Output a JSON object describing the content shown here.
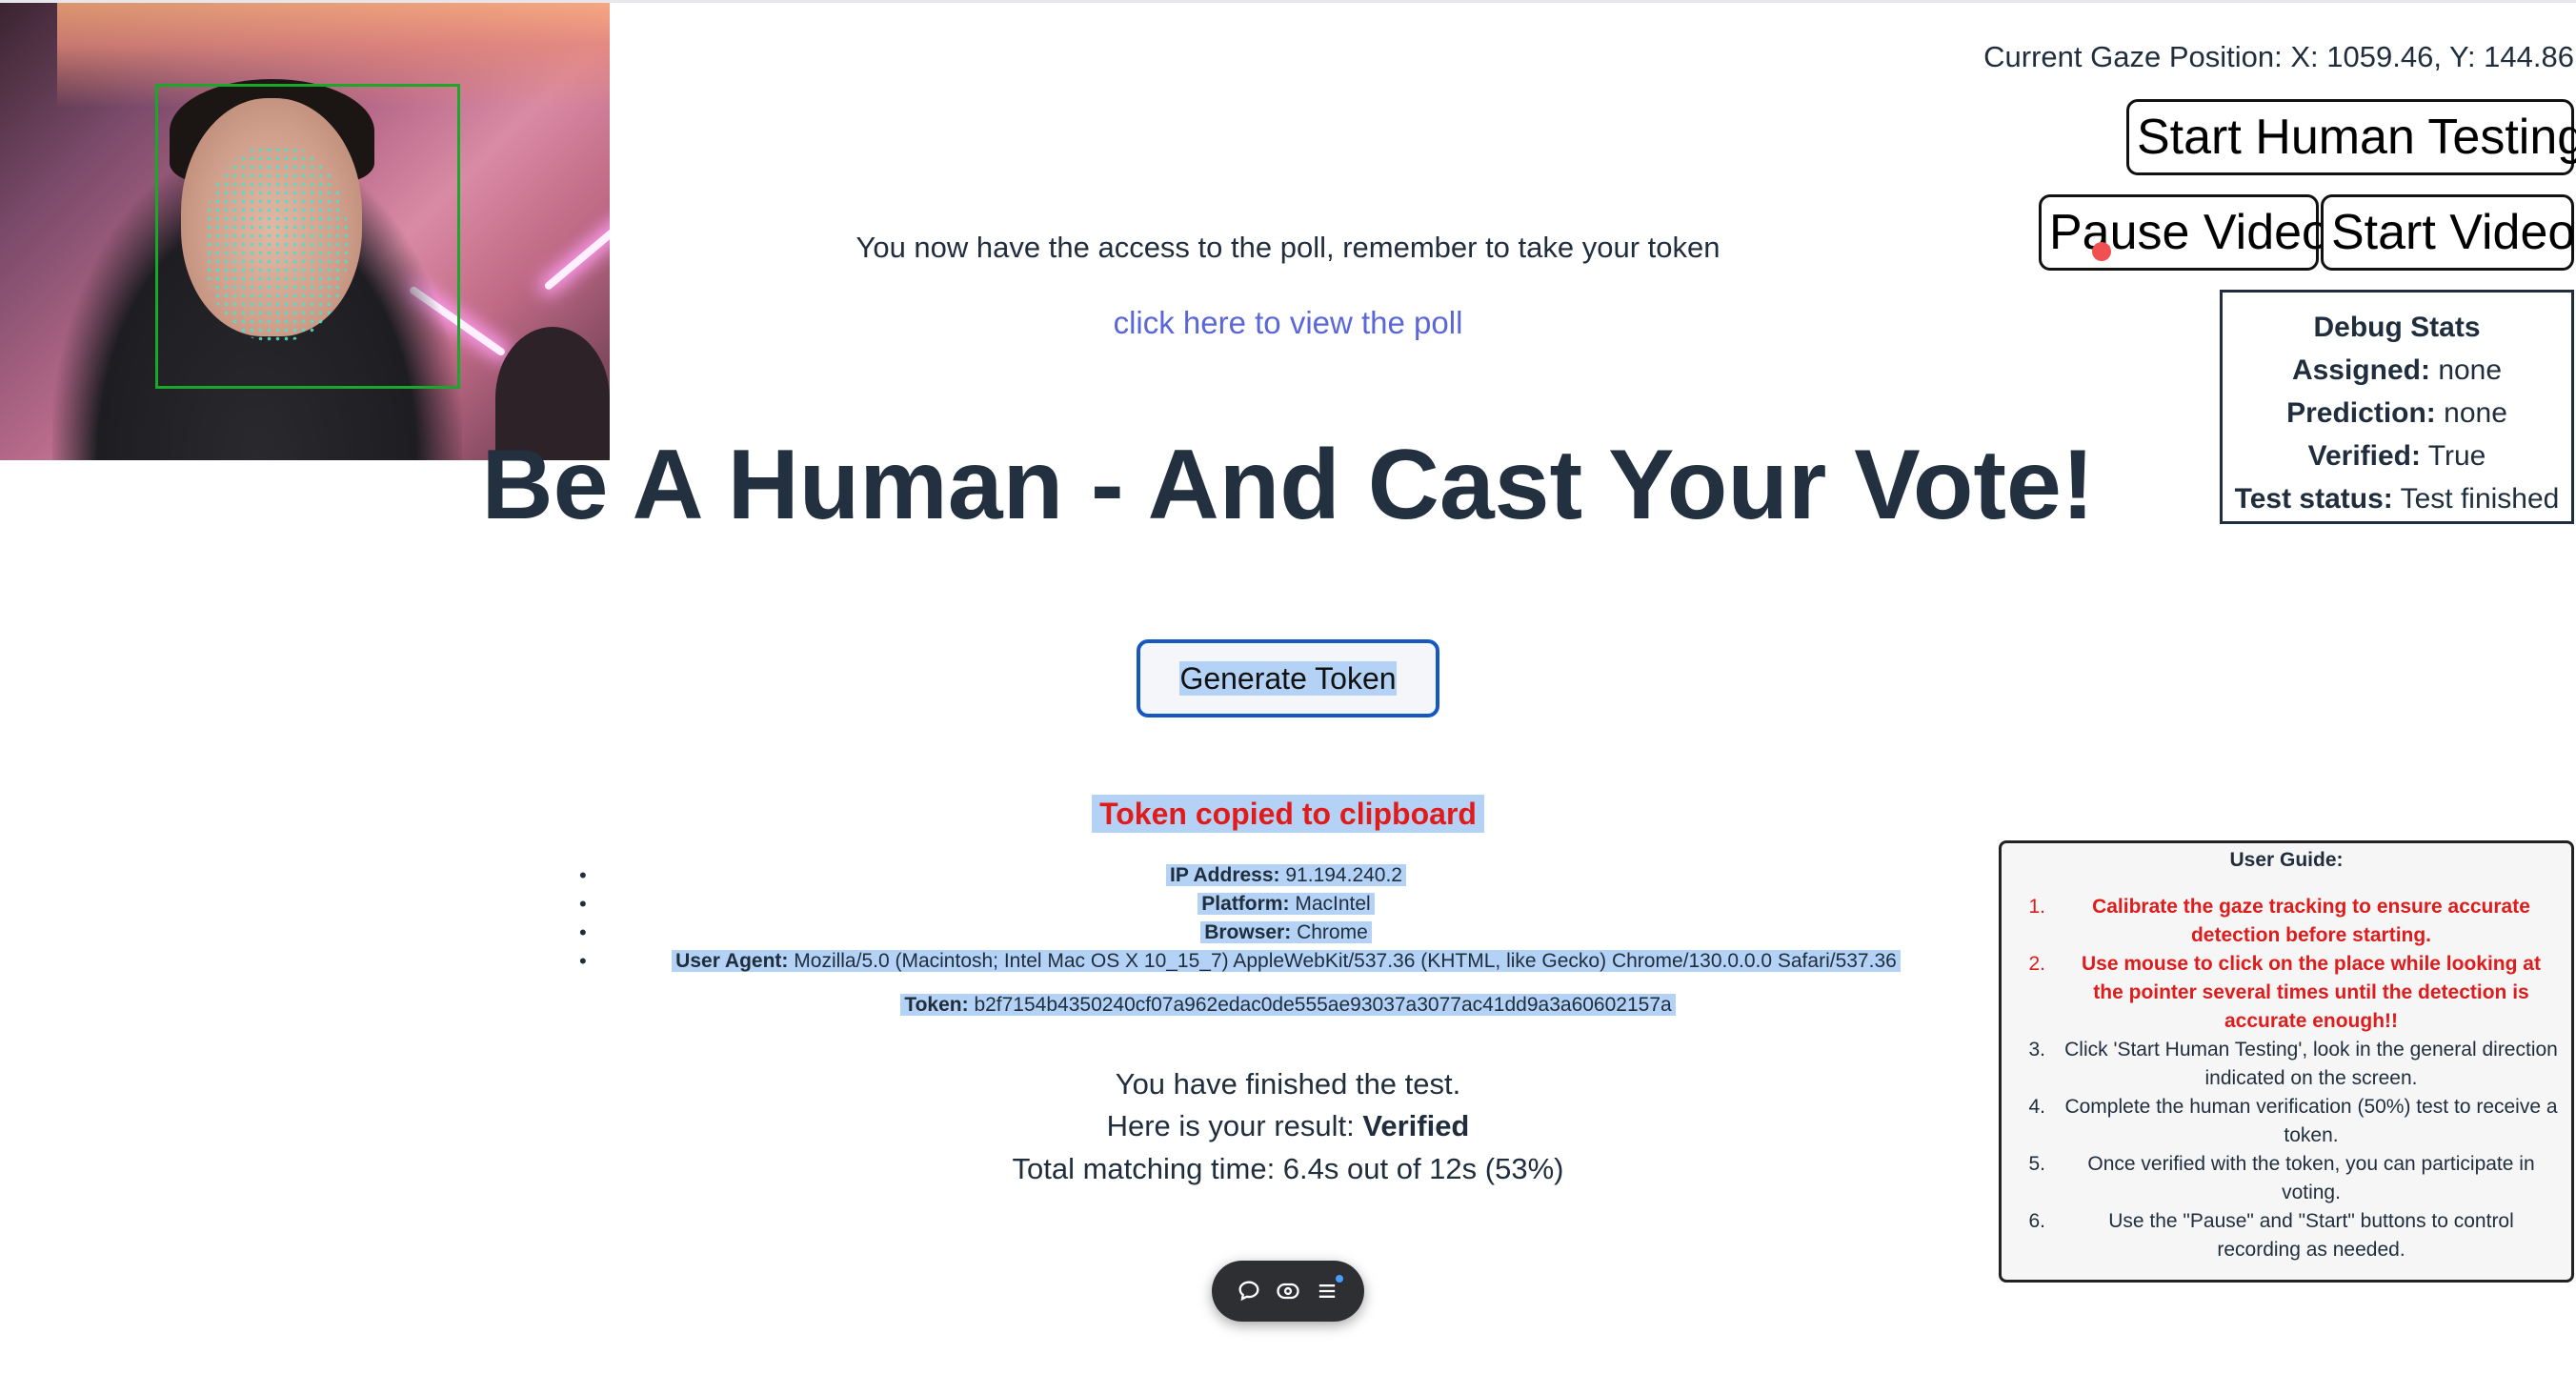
{
  "gaze": {
    "text": "Current Gaze Position: X: 1059.46, Y: 144.86"
  },
  "buttons": {
    "start_human_testing": "Start Human Testing",
    "pause_video": "Pause Video",
    "start_video": "Start Video",
    "generate_token": "Generate Token"
  },
  "debug": {
    "title": "Debug Stats",
    "rows": [
      {
        "label": "Assigned:",
        "value": "none"
      },
      {
        "label": "Prediction:",
        "value": "none"
      },
      {
        "label": "Verified:",
        "value": "True"
      },
      {
        "label": "Test status:",
        "value": "Test finished"
      }
    ]
  },
  "main": {
    "access_message": "You now have the access to the poll, remember to take your token",
    "poll_link": "click here to view the poll",
    "headline": "Be A Human - And Cast Your Vote!",
    "copied_message": "Token copied to clipboard",
    "info": [
      {
        "label": "IP Address:",
        "value": "91.194.240.2"
      },
      {
        "label": "Platform:",
        "value": "MacIntel"
      },
      {
        "label": "Browser:",
        "value": "Chrome"
      },
      {
        "label": "User Agent:",
        "value": "Mozilla/5.0 (Macintosh; Intel Mac OS X 10_15_7) AppleWebKit/537.36 (KHTML, like Gecko) Chrome/130.0.0.0 Safari/537.36"
      }
    ],
    "token_label": "Token:",
    "token_value": "b2f7154b4350240cf07a962edac0de555ae93037a3077ac41dd9a3a60602157a",
    "finished": "You have finished the test.",
    "result_prefix": "Here is your result:",
    "result_value": "Verified",
    "matching": "Total matching time: 6.4s out of 12s (53%)"
  },
  "guide": {
    "title": "User Guide:",
    "items": [
      {
        "num": "1.",
        "text": "Calibrate the gaze tracking to ensure accurate detection before starting."
      },
      {
        "num": "2.",
        "text": "Use mouse to click on the place while looking at the pointer several times until the detection is accurate enough!!"
      },
      {
        "num": "3.",
        "text": "Click 'Start Human Testing', look in the general direction indicated on the screen."
      },
      {
        "num": "4.",
        "text": "Complete the human verification (50%) test to receive a token."
      },
      {
        "num": "5.",
        "text": "Once verified with the token, you can participate in voting."
      },
      {
        "num": "6.",
        "text": "Use the \"Pause\" and \"Start\" buttons to control recording as needed."
      }
    ]
  },
  "toolbar": {
    "icons": [
      "chat-bubble-icon",
      "eye-toggle-icon",
      "menu-list-icon"
    ]
  },
  "colors": {
    "accent_link": "#5a67d8",
    "alert_red": "#e01b1b",
    "selection": "#b4d2f5",
    "button_border_blue": "#1558c0"
  }
}
